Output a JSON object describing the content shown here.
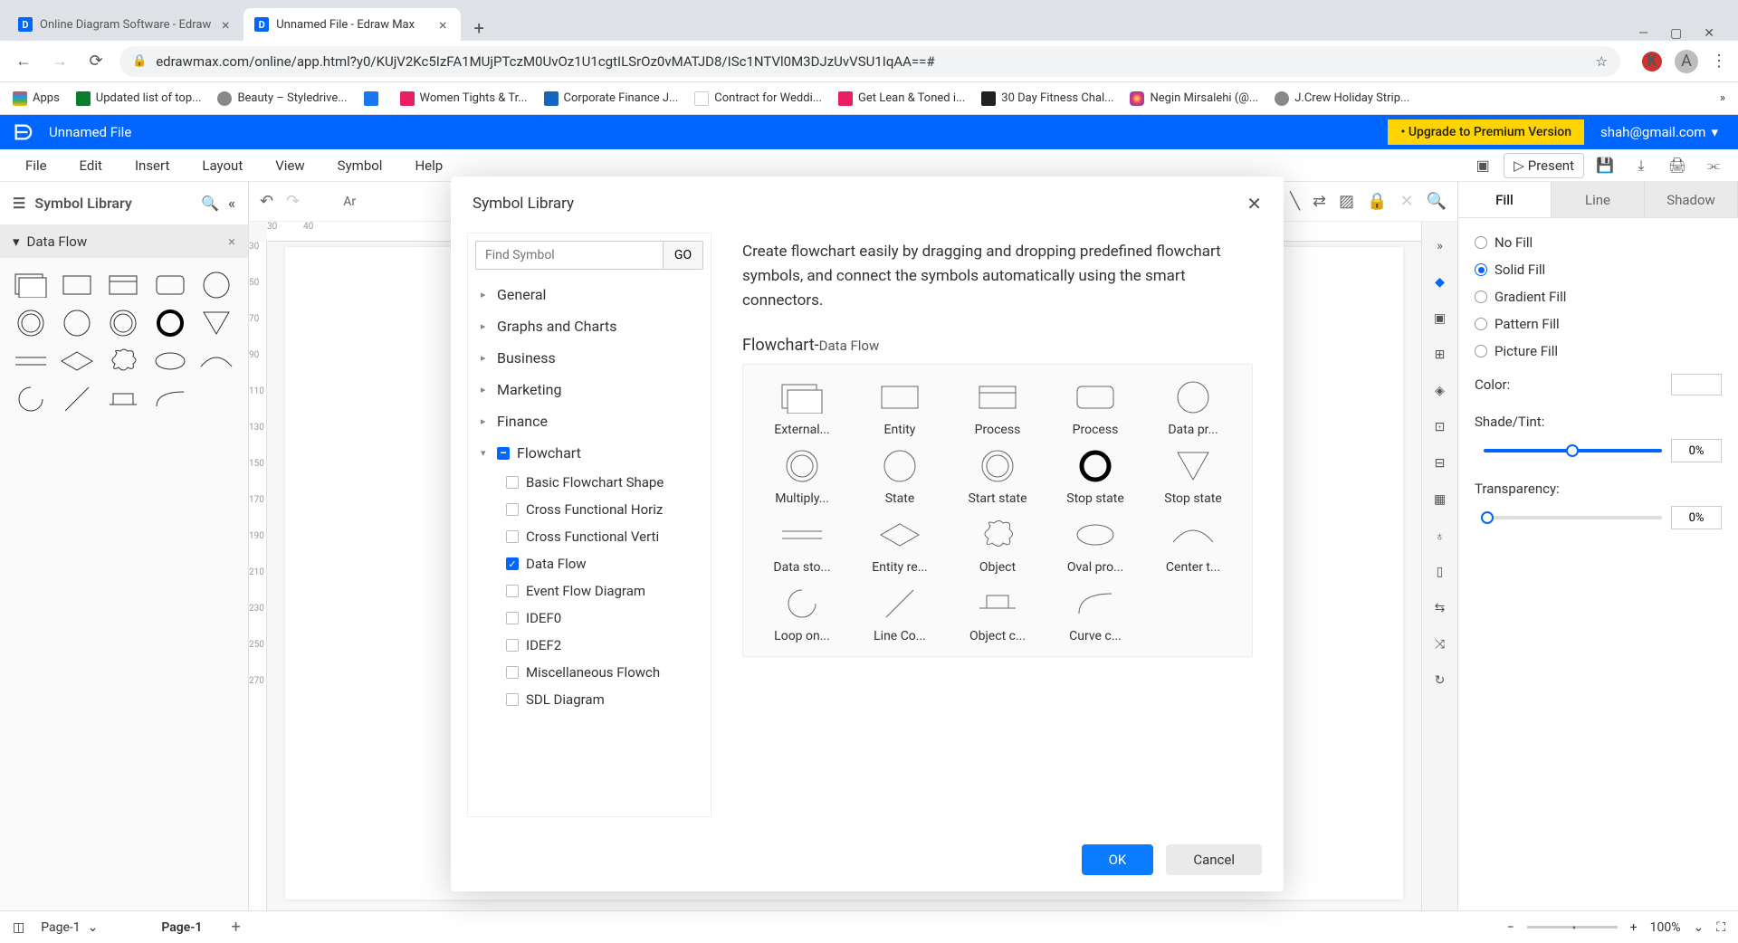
{
  "browser": {
    "tabs": [
      {
        "icon": "D",
        "title": "Online Diagram Software - Edraw",
        "active": false
      },
      {
        "icon": "D",
        "title": "Unnamed File - Edraw Max",
        "active": true
      }
    ],
    "url": "edrawmax.com/online/app.html?y0/KUjV2Kc5IzFA1MUjPTczM0UvOz1U1cgtILSrOz0vMATJD8/ISc1NTVl0M3DJzUvVSU1IqAA==#",
    "bookmarks": [
      "Apps",
      "Updated list of top...",
      "Beauty – Styledrive...",
      "",
      "Women Tights & Tr...",
      "Corporate Finance J...",
      "Contract for Weddi...",
      "Get Lean & Toned i...",
      "30 Day Fitness Chal...",
      "Negin Mirsalehi (@...",
      "J.Crew Holiday Strip..."
    ]
  },
  "app": {
    "filename": "Unnamed File",
    "upgrade": "• Upgrade to Premium Version",
    "email": "shah@gmail.com"
  },
  "menu": [
    "File",
    "Edit",
    "Insert",
    "Layout",
    "View",
    "Symbol",
    "Help"
  ],
  "present": "Present",
  "sidebar": {
    "title": "Symbol Library",
    "category": "Data Flow"
  },
  "modal": {
    "title": "Symbol Library",
    "search_placeholder": "Find Symbol",
    "go": "GO",
    "categories": [
      "General",
      "Graphs and Charts",
      "Business",
      "Marketing",
      "Finance",
      "Flowchart"
    ],
    "flowchart_subs": [
      {
        "label": "Basic Flowchart Shape",
        "checked": false
      },
      {
        "label": "Cross Functional Horiz",
        "checked": false
      },
      {
        "label": "Cross Functional Verti",
        "checked": false
      },
      {
        "label": "Data Flow",
        "checked": true
      },
      {
        "label": "Event Flow Diagram",
        "checked": false
      },
      {
        "label": "IDEF0",
        "checked": false
      },
      {
        "label": "IDEF2",
        "checked": false
      },
      {
        "label": "Miscellaneous Flowch",
        "checked": false
      },
      {
        "label": "SDL Diagram",
        "checked": false
      }
    ],
    "description": "Create flowchart easily by dragging and dropping predefined flowchart symbols, and connect the symbols automatically using the smart connectors.",
    "section_title": "Flowchart-",
    "section_sub": "Data Flow",
    "symbols": [
      "External...",
      "Entity",
      "Process",
      "Process",
      "Data pr...",
      "Multiply...",
      "State",
      "Start state",
      "Stop state",
      "Stop state",
      "Data sto...",
      "Entity re...",
      "Object",
      "Oval pro...",
      "Center t...",
      "Loop on...",
      "Line Co...",
      "Object c...",
      "Curve c..."
    ],
    "ok": "OK",
    "cancel": "Cancel"
  },
  "props": {
    "tabs": [
      "Fill",
      "Line",
      "Shadow"
    ],
    "fill_options": [
      "No Fill",
      "Solid Fill",
      "Gradient Fill",
      "Pattern Fill",
      "Picture Fill"
    ],
    "selected_fill": 1,
    "color_label": "Color:",
    "shade_label": "Shade/Tint:",
    "shade_val": "0%",
    "transparency_label": "Transparency:",
    "transparency_val": "0%"
  },
  "status": {
    "page_sel": "Page-1",
    "page_tab": "Page-1",
    "zoom": "100%"
  }
}
